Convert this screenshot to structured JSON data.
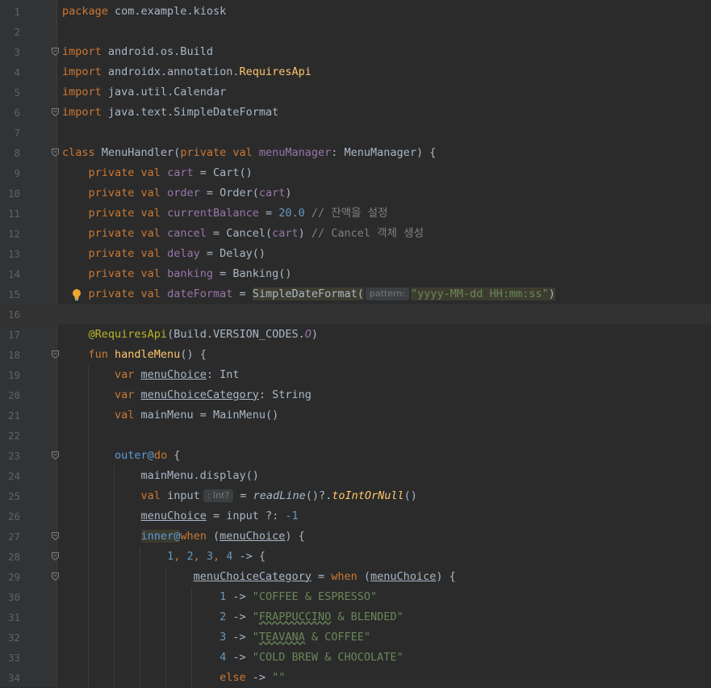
{
  "editor": {
    "language": "kotlin",
    "current_line": 16,
    "colors": {
      "background": "#2b2b2b",
      "gutter": "#313335",
      "keyword": "#cc7832",
      "function": "#ffc66d",
      "property": "#9876aa",
      "number": "#6897bb",
      "string": "#6a8759",
      "comment": "#808080",
      "annotation": "#bbb529"
    },
    "hints": {
      "pattern_hint": "pattern:",
      "type_hint": ": Int?"
    },
    "lines": [
      {
        "n": "1",
        "t": [
          {
            "c": "kw",
            "v": "package "
          },
          {
            "c": "",
            "v": "com.example.kiosk"
          }
        ]
      },
      {
        "n": "2",
        "t": []
      },
      {
        "n": "3",
        "fold": true,
        "t": [
          {
            "c": "kw",
            "v": "import "
          },
          {
            "c": "",
            "v": "android.os.Build"
          }
        ]
      },
      {
        "n": "4",
        "t": [
          {
            "c": "kw",
            "v": "import "
          },
          {
            "c": "",
            "v": "androidx.annotation."
          },
          {
            "c": "fn",
            "v": "RequiresApi"
          }
        ]
      },
      {
        "n": "5",
        "t": [
          {
            "c": "kw",
            "v": "import "
          },
          {
            "c": "",
            "v": "java.util.Calendar"
          }
        ]
      },
      {
        "n": "6",
        "fold": true,
        "t": [
          {
            "c": "kw",
            "v": "import "
          },
          {
            "c": "",
            "v": "java.text.SimpleDateFormat"
          }
        ]
      },
      {
        "n": "7",
        "t": []
      },
      {
        "n": "8",
        "fold": true,
        "t": [
          {
            "c": "kw",
            "v": "class "
          },
          {
            "c": "",
            "v": "MenuHandler("
          },
          {
            "c": "kw",
            "v": "private val "
          },
          {
            "c": "prop",
            "v": "menuManager"
          },
          {
            "c": "",
            "v": ": MenuManager) {"
          }
        ]
      },
      {
        "n": "9",
        "t": [
          {
            "c": "",
            "v": "    "
          },
          {
            "c": "kw",
            "v": "private val "
          },
          {
            "c": "prop",
            "v": "cart"
          },
          {
            "c": "",
            "v": " = Cart()"
          }
        ]
      },
      {
        "n": "10",
        "t": [
          {
            "c": "",
            "v": "    "
          },
          {
            "c": "kw",
            "v": "private val "
          },
          {
            "c": "prop",
            "v": "order"
          },
          {
            "c": "",
            "v": " = Order("
          },
          {
            "c": "prop",
            "v": "cart"
          },
          {
            "c": "",
            "v": ")"
          }
        ]
      },
      {
        "n": "11",
        "t": [
          {
            "c": "",
            "v": "    "
          },
          {
            "c": "kw",
            "v": "private val "
          },
          {
            "c": "prop",
            "v": "currentBalance"
          },
          {
            "c": "",
            "v": " = "
          },
          {
            "c": "num",
            "v": "20.0"
          },
          {
            "c": "cmt",
            "v": " // 잔액을 설정"
          }
        ]
      },
      {
        "n": "12",
        "t": [
          {
            "c": "",
            "v": "    "
          },
          {
            "c": "kw",
            "v": "private val "
          },
          {
            "c": "prop",
            "v": "cancel"
          },
          {
            "c": "",
            "v": " = Cancel("
          },
          {
            "c": "prop",
            "v": "cart"
          },
          {
            "c": "",
            "v": ")"
          },
          {
            "c": "cmt",
            "v": " // Cancel 객체 생성"
          }
        ]
      },
      {
        "n": "13",
        "t": [
          {
            "c": "",
            "v": "    "
          },
          {
            "c": "kw",
            "v": "private val "
          },
          {
            "c": "prop",
            "v": "delay"
          },
          {
            "c": "",
            "v": " = Delay()"
          }
        ]
      },
      {
        "n": "14",
        "t": [
          {
            "c": "",
            "v": "    "
          },
          {
            "c": "kw",
            "v": "private val "
          },
          {
            "c": "prop",
            "v": "banking"
          },
          {
            "c": "",
            "v": " = Banking()"
          }
        ]
      },
      {
        "n": "15",
        "bulb": true,
        "t": [
          {
            "c": "",
            "v": "    "
          },
          {
            "c": "kw",
            "v": "private val "
          },
          {
            "c": "prop",
            "v": "dateFormat"
          },
          {
            "c": "",
            "v": " = "
          },
          {
            "c": "hlbox",
            "v": "SimpleDateFormat("
          },
          {
            "c": "hint-pattern",
            "v": ""
          },
          {
            "c": "hlbox str",
            "v": "\"yyyy-MM-dd HH:mm:ss\""
          },
          {
            "c": "hlbox",
            "v": ")"
          }
        ]
      },
      {
        "n": "16",
        "t": []
      },
      {
        "n": "17",
        "t": [
          {
            "c": "",
            "v": "    "
          },
          {
            "c": "ann",
            "v": "@RequiresApi"
          },
          {
            "c": "",
            "v": "(Build.VERSION_CODES."
          },
          {
            "c": "prop it",
            "v": "O"
          },
          {
            "c": "",
            "v": ")"
          }
        ]
      },
      {
        "n": "18",
        "fold": true,
        "t": [
          {
            "c": "",
            "v": "    "
          },
          {
            "c": "kw",
            "v": "fun "
          },
          {
            "c": "fn",
            "v": "handleMenu"
          },
          {
            "c": "",
            "v": "() {"
          }
        ]
      },
      {
        "n": "19",
        "t": [
          {
            "c": "",
            "v": "        "
          },
          {
            "c": "kw",
            "v": "var "
          },
          {
            "c": "ul",
            "v": "menuChoice"
          },
          {
            "c": "",
            "v": ": Int"
          }
        ]
      },
      {
        "n": "20",
        "t": [
          {
            "c": "",
            "v": "        "
          },
          {
            "c": "kw",
            "v": "var "
          },
          {
            "c": "ul",
            "v": "menuChoiceCategory"
          },
          {
            "c": "",
            "v": ": String"
          }
        ]
      },
      {
        "n": "21",
        "t": [
          {
            "c": "",
            "v": "        "
          },
          {
            "c": "kw",
            "v": "val "
          },
          {
            "c": "",
            "v": "mainMenu = MainMenu()"
          }
        ]
      },
      {
        "n": "22",
        "t": []
      },
      {
        "n": "23",
        "fold": true,
        "t": [
          {
            "c": "",
            "v": "        "
          },
          {
            "c": "lbl",
            "v": "outer@"
          },
          {
            "c": "kw",
            "v": "do "
          },
          {
            "c": "",
            "v": "{"
          }
        ]
      },
      {
        "n": "24",
        "t": [
          {
            "c": "",
            "v": "            mainMenu.display()"
          }
        ]
      },
      {
        "n": "25",
        "t": [
          {
            "c": "",
            "v": "            "
          },
          {
            "c": "kw",
            "v": "val "
          },
          {
            "c": "",
            "v": "input"
          },
          {
            "c": "hint-type",
            "v": ""
          },
          {
            "c": "",
            "v": " = "
          },
          {
            "c": "it",
            "v": "readLine"
          },
          {
            "c": "",
            "v": "()?."
          },
          {
            "c": "fn it",
            "v": "toIntOrNull"
          },
          {
            "c": "",
            "v": "()"
          }
        ]
      },
      {
        "n": "26",
        "t": [
          {
            "c": "",
            "v": "            "
          },
          {
            "c": "ul",
            "v": "menuChoice"
          },
          {
            "c": "",
            "v": " = input ?: "
          },
          {
            "c": "num",
            "v": "-1"
          }
        ]
      },
      {
        "n": "27",
        "fold": true,
        "t": [
          {
            "c": "",
            "v": "            "
          },
          {
            "c": "lbl hl",
            "v": "inner@"
          },
          {
            "c": "kw",
            "v": "when "
          },
          {
            "c": "",
            "v": "("
          },
          {
            "c": "ul",
            "v": "menuChoice"
          },
          {
            "c": "",
            "v": ") {"
          }
        ]
      },
      {
        "n": "28",
        "fold": true,
        "t": [
          {
            "c": "",
            "v": "                "
          },
          {
            "c": "num",
            "v": "1"
          },
          {
            "c": "kw",
            "v": ", "
          },
          {
            "c": "num",
            "v": "2"
          },
          {
            "c": "kw",
            "v": ", "
          },
          {
            "c": "num",
            "v": "3"
          },
          {
            "c": "kw",
            "v": ", "
          },
          {
            "c": "num",
            "v": "4"
          },
          {
            "c": "",
            "v": " -> {"
          }
        ]
      },
      {
        "n": "29",
        "fold": true,
        "t": [
          {
            "c": "",
            "v": "                    "
          },
          {
            "c": "ul",
            "v": "menuChoiceCategory"
          },
          {
            "c": "",
            "v": " = "
          },
          {
            "c": "kw",
            "v": "when "
          },
          {
            "c": "",
            "v": "("
          },
          {
            "c": "ul",
            "v": "menuChoice"
          },
          {
            "c": "",
            "v": ") {"
          }
        ]
      },
      {
        "n": "30",
        "t": [
          {
            "c": "",
            "v": "                        "
          },
          {
            "c": "num",
            "v": "1"
          },
          {
            "c": "",
            "v": " -> "
          },
          {
            "c": "str",
            "v": "\"COFFEE & ESPRESSO\""
          }
        ]
      },
      {
        "n": "31",
        "t": [
          {
            "c": "",
            "v": "                        "
          },
          {
            "c": "num",
            "v": "2"
          },
          {
            "c": "",
            "v": " -> "
          },
          {
            "c": "str",
            "v": "\""
          },
          {
            "c": "str wavy",
            "v": "FRAPPUCCINO"
          },
          {
            "c": "str",
            "v": " & BLENDED\""
          }
        ]
      },
      {
        "n": "32",
        "t": [
          {
            "c": "",
            "v": "                        "
          },
          {
            "c": "num",
            "v": "3"
          },
          {
            "c": "",
            "v": " -> "
          },
          {
            "c": "str",
            "v": "\""
          },
          {
            "c": "str wavy",
            "v": "TEAVANA"
          },
          {
            "c": "str",
            "v": " & COFFEE\""
          }
        ]
      },
      {
        "n": "33",
        "t": [
          {
            "c": "",
            "v": "                        "
          },
          {
            "c": "num",
            "v": "4"
          },
          {
            "c": "",
            "v": " -> "
          },
          {
            "c": "str",
            "v": "\"COLD BREW & CHOCOLATE\""
          }
        ]
      },
      {
        "n": "34",
        "t": [
          {
            "c": "",
            "v": "                        "
          },
          {
            "c": "kw",
            "v": "else "
          },
          {
            "c": "",
            "v": "-> "
          },
          {
            "c": "str",
            "v": "\"\""
          }
        ]
      }
    ]
  }
}
